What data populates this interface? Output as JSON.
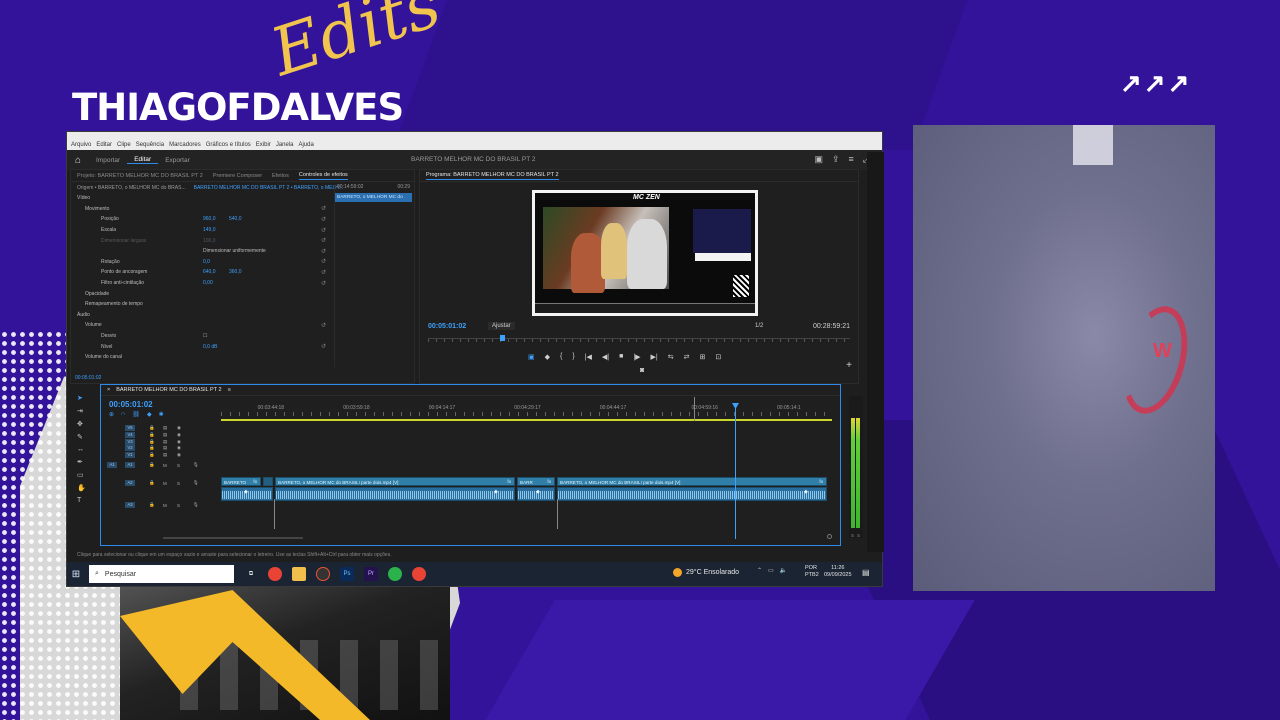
{
  "branding": {
    "channel_name": "THIAGOFDALVES",
    "script_word": "Edits",
    "corner_arrows": "↗↗↗"
  },
  "menu": [
    "Arquivo",
    "Editar",
    "Clipe",
    "Sequência",
    "Marcadores",
    "Gráficos e títulos",
    "Exibir",
    "Janela",
    "Ajuda"
  ],
  "toolbar": {
    "tabs": [
      "Importar",
      "Editar",
      "Exportar"
    ],
    "active_tab": "Editar",
    "document_title": "BARRETO MELHOR MC DO BRASIL PT 2"
  },
  "effect_controls": {
    "tabs": [
      "Projeto: BARRETO MELHOR MC DO BRASIL PT 2",
      "Premiere Composer",
      "Efeitos",
      "Controles de efeitos"
    ],
    "active_tab": "Controles de efeitos",
    "source": "Origem • BARRETO, o MELHOR MC do BRAS...",
    "sequence_clip": "BARRETO MELHOR MC DO BRASIL PT 2 • BARRETO, o MELH...",
    "section_video": "Vídeo",
    "rows": [
      {
        "label": "Movimento",
        "v1": "",
        "v2": "",
        "level": 1
      },
      {
        "label": "Posição",
        "v1": "960,0",
        "v2": "540,0",
        "level": 2
      },
      {
        "label": "Escala",
        "v1": "149,0",
        "v2": "",
        "level": 2
      },
      {
        "label": "Dimensionar largura",
        "v1": "100,0",
        "v2": "",
        "level": 2,
        "dim": true
      },
      {
        "label": "",
        "v1": "Dimensionar uniformemente",
        "v2": "",
        "level": 2
      },
      {
        "label": "Rotação",
        "v1": "0,0",
        "v2": "",
        "level": 2
      },
      {
        "label": "Ponto de ancoragem",
        "v1": "640,0",
        "v2": "360,0",
        "level": 2
      },
      {
        "label": "Filtro anti-cintilação",
        "v1": "0,00",
        "v2": "",
        "level": 2
      },
      {
        "label": "Opacidade",
        "v1": "",
        "v2": "",
        "level": 1
      },
      {
        "label": "Remapeamento de tempo",
        "v1": "",
        "v2": "",
        "level": 1
      },
      {
        "label": "Áudio",
        "v1": "",
        "v2": "",
        "level": 0
      },
      {
        "label": "Volume",
        "v1": "",
        "v2": "",
        "level": 1
      },
      {
        "label": "Desvio",
        "v1": "",
        "v2": "",
        "level": 2
      },
      {
        "label": "Nível",
        "v1": "0,0 dB",
        "v2": "",
        "level": 2
      },
      {
        "label": "Volume do canal",
        "v1": "",
        "v2": "",
        "level": 1
      }
    ],
    "mini_times": [
      "00:14:59:02",
      "00:29"
    ],
    "mini_clip": "BARRETO, o MELHOR MC do",
    "timecode": "00:05:01:02"
  },
  "program_monitor": {
    "title": "Programa: BARRETO MELHOR MC DO BRASIL PT 2",
    "overlay_text": "MC ZEN",
    "timecode": "00:05:01:02",
    "fit": "Ajustar",
    "resolution": "1/2",
    "duration": "00:28:59:21",
    "buttons": [
      "▣",
      "◆",
      "{",
      "}",
      "|◀",
      "◀|",
      "■",
      "|▶",
      "▶|",
      "⇆",
      "⇄",
      "⊞",
      "⊡"
    ]
  },
  "timeline": {
    "title": "BARRETO MELHOR MC DO BRASIL PT 2",
    "timecode": "00:05:01:02",
    "ruler": [
      "00:03:44:18",
      "00:03:59:18",
      "00:04:14:17",
      "00:04:29:17",
      "00:04:44:17",
      "00:04:59:16",
      "00:05:14:1"
    ],
    "video_tracks": [
      "V5",
      "V4",
      "V3",
      "V2",
      "V1"
    ],
    "audio_tracks": [
      "A1",
      "A2",
      "A3"
    ],
    "clips": [
      {
        "label": "BARRETO",
        "track": "V1"
      },
      {
        "label": "BARRETO, o MELHOR MC do BRASIL! parte dois.mp4 [V]",
        "track": "V1"
      },
      {
        "label": "BARR",
        "track": "V1"
      },
      {
        "label": "BARRETO, o MELHOR MC do BRASIL! parte dois.mp4 [V]",
        "track": "V1"
      }
    ],
    "meter_labels": [
      "S",
      "S"
    ]
  },
  "status_text": "Clique para selecionar ou clique em um espaço vazio e arraste para selecionar o letreiro. Use as teclas Shift+Alt+Ctrl para obter mais opções.",
  "taskbar": {
    "search_placeholder": "Pesquisar",
    "weather": "29°C  Ensolarado",
    "lang_1": "POR",
    "lang_2": "PTB2",
    "time": "11:26",
    "date": "09/09/2025"
  }
}
